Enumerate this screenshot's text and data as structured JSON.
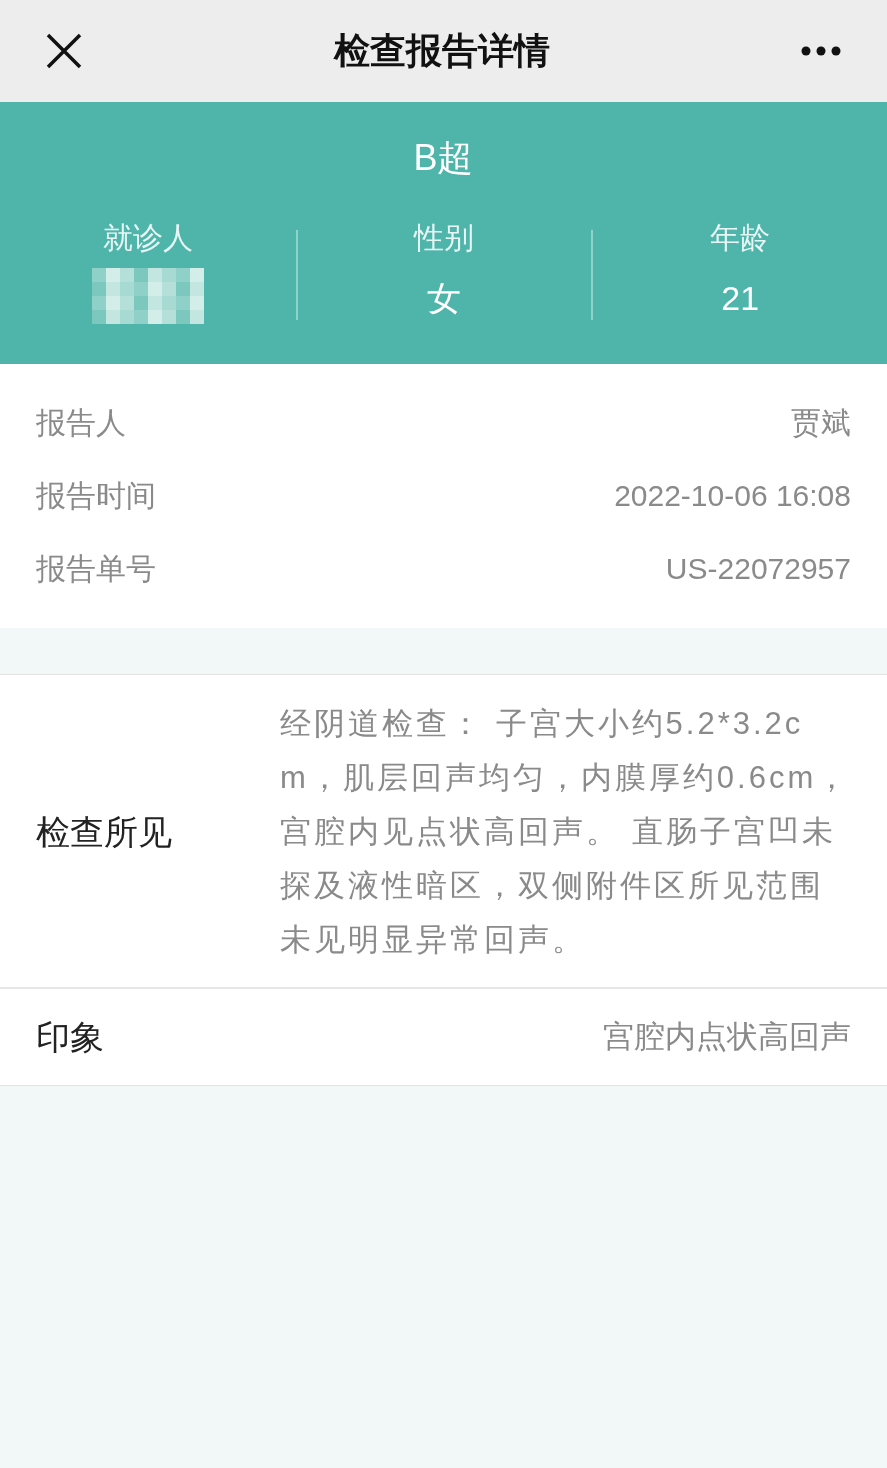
{
  "nav": {
    "title": "检查报告详情"
  },
  "header": {
    "exam_type": "B超",
    "fields": [
      {
        "label": "就诊人",
        "redacted": true
      },
      {
        "label": "性别",
        "redacted": false,
        "value": "女"
      },
      {
        "label": "年龄",
        "redacted": false,
        "value": "21"
      }
    ]
  },
  "info": [
    {
      "label": "报告人",
      "value": "贾斌"
    },
    {
      "label": "报告时间",
      "value": "2022-10-06 16:08"
    },
    {
      "label": "报告单号",
      "value": "US-22072957"
    }
  ],
  "findings": {
    "label": "检查所见",
    "text": "经阴道检查： 子宫大小约5.2*3.2cm，肌层回声均匀，内膜厚约0.6cm，宫腔内见点状高回声。 直肠子宫凹未探及液性暗区，双侧附件区所见范围未见明显异常回声。"
  },
  "impression": {
    "label": "印象",
    "value": "宫腔内点状高回声"
  }
}
